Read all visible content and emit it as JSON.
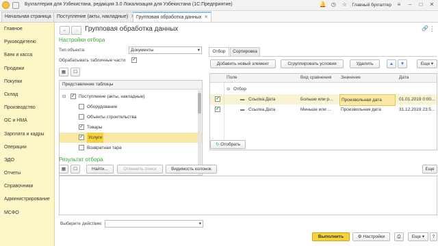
{
  "window": {
    "title": "Бухгалтерия для Узбекистана, редакция 3.0 Локализация для Узбекистана  (1С:Предприятие)",
    "user": "Главный бухгалтер"
  },
  "tabs": [
    {
      "label": "Начальная страница"
    },
    {
      "label": "Поступление (акты, накладные)"
    },
    {
      "label": "Групповая обработка данных"
    }
  ],
  "sidebar": {
    "items": [
      {
        "label": "Главное"
      },
      {
        "label": "Руководителю"
      },
      {
        "label": "Банк и касса"
      },
      {
        "label": "Продажи"
      },
      {
        "label": "Покупки"
      },
      {
        "label": "Склад"
      },
      {
        "label": "Производство"
      },
      {
        "label": "ОС и НМА"
      },
      {
        "label": "Зарплата и кадры"
      },
      {
        "label": "Операции"
      },
      {
        "label": "ЭДО"
      },
      {
        "label": "Отчеты"
      },
      {
        "label": "Справочники"
      },
      {
        "label": "Администрирование"
      },
      {
        "label": "МСФО"
      }
    ]
  },
  "form": {
    "title": "Групповая обработка данных",
    "filter_section": "Настройки отбора",
    "object_type_label": "Тип объекта:",
    "object_type_value": "Документы",
    "process_tables_label": "Обрабатывать табличные части:",
    "table_view_header": "Представление таблицы",
    "tree": [
      {
        "label": "Поступление (акты, накладные)",
        "checked": true,
        "level": 0
      },
      {
        "label": "Оборудование",
        "checked": false,
        "level": 1
      },
      {
        "label": "Объекты строительства",
        "checked": false,
        "level": 1
      },
      {
        "label": "Товары",
        "checked": true,
        "level": 1
      },
      {
        "label": "Услуги",
        "checked": true,
        "level": 1
      },
      {
        "label": "Возвратная тара",
        "checked": false,
        "level": 1
      }
    ],
    "right_tabs": [
      {
        "label": "Отбор"
      },
      {
        "label": "Сортировка"
      }
    ],
    "add_element_button": "Добавить новый элемент",
    "group_conditions_button": "Сгруппировать условия",
    "delete_button": "Удалить",
    "more_button": "Еще",
    "grid_columns": {
      "field": "Поле",
      "comparison": "Вид сравнения",
      "value": "Значение",
      "date": "Дата"
    },
    "grid_group": "Отбор",
    "grid_rows": [
      {
        "field": "Ссылка.Дата",
        "comparison": "Больше или р...",
        "value": "Произвольная дата",
        "date": "01.01.2019 0:00..."
      },
      {
        "field": "Ссылка.Дата",
        "comparison": "Меньше или ...",
        "value": "Произвольная дата",
        "date": "31.12.2019 23:5..."
      }
    ],
    "select_button": "Отобрать",
    "result_section": "Результат отбора",
    "find_button": "Найти...",
    "cancel_search_button": "Отменить поиск",
    "columns_visibility_button": "Видимость колонок",
    "result_more_button": "Еще",
    "action_label": "Выберите действие:",
    "action_value": "",
    "execute_button": "Выполнить",
    "settings_button": "Настройки",
    "bottom_more_button": "Еще",
    "help_button": "?"
  },
  "colors": {
    "accent_green": "#3aa537",
    "sidebar_bg": "#fdf7c8",
    "execute_yellow": "#f5d23b"
  }
}
